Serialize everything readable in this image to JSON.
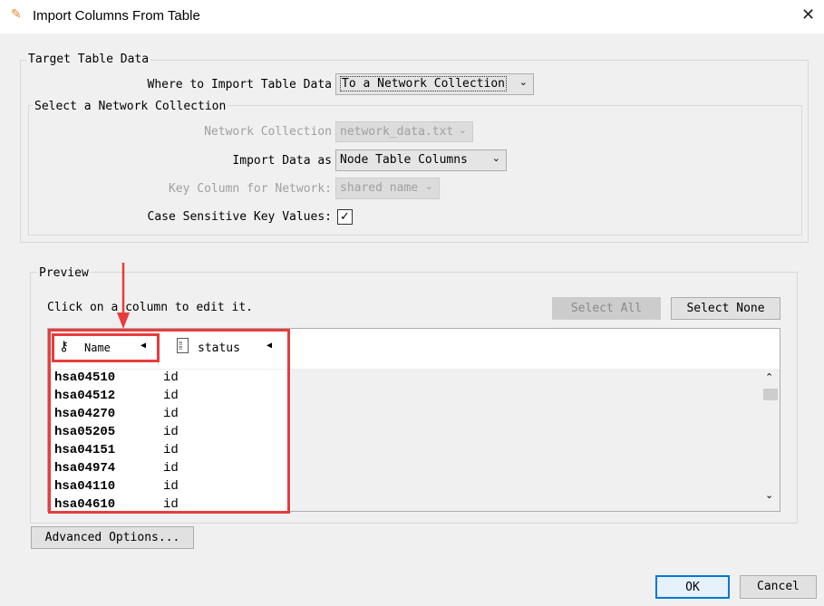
{
  "window": {
    "title": "Import Columns From Table",
    "close_icon": "close-icon",
    "app_icon": "cytoscape-icon"
  },
  "target": {
    "group_title": "Target Table Data",
    "where_label": "Where to Import Table Data",
    "where_value": "To a Network Collection",
    "subgroup_title": "Select a Network Collection",
    "collection_label": "Network Collection",
    "collection_value": "network_data.txt",
    "import_as_label": "Import Data as",
    "import_as_value": "Node Table Columns",
    "key_label": "Key Column for Network:",
    "key_value": "shared name",
    "case_label": "Case Sensitive Key Values:",
    "case_checked": true
  },
  "preview": {
    "group_title": "Preview",
    "hint": "Click on a column to edit it.",
    "select_all": "Select All",
    "select_none": "Select None",
    "columns": [
      {
        "name": "Name",
        "icon": "key-icon"
      },
      {
        "name": "status",
        "icon": "document-icon"
      }
    ],
    "rows": [
      [
        "hsa04510",
        "id"
      ],
      [
        "hsa04512",
        "id"
      ],
      [
        "hsa04270",
        "id"
      ],
      [
        "hsa05205",
        "id"
      ],
      [
        "hsa04151",
        "id"
      ],
      [
        "hsa04974",
        "id"
      ],
      [
        "hsa04110",
        "id"
      ],
      [
        "hsa04610",
        "id"
      ]
    ]
  },
  "footer": {
    "advanced": "Advanced Options...",
    "ok": "OK",
    "cancel": "Cancel"
  },
  "colors": {
    "annotation": "#e83c3c",
    "ok_border": "#0078d7"
  }
}
